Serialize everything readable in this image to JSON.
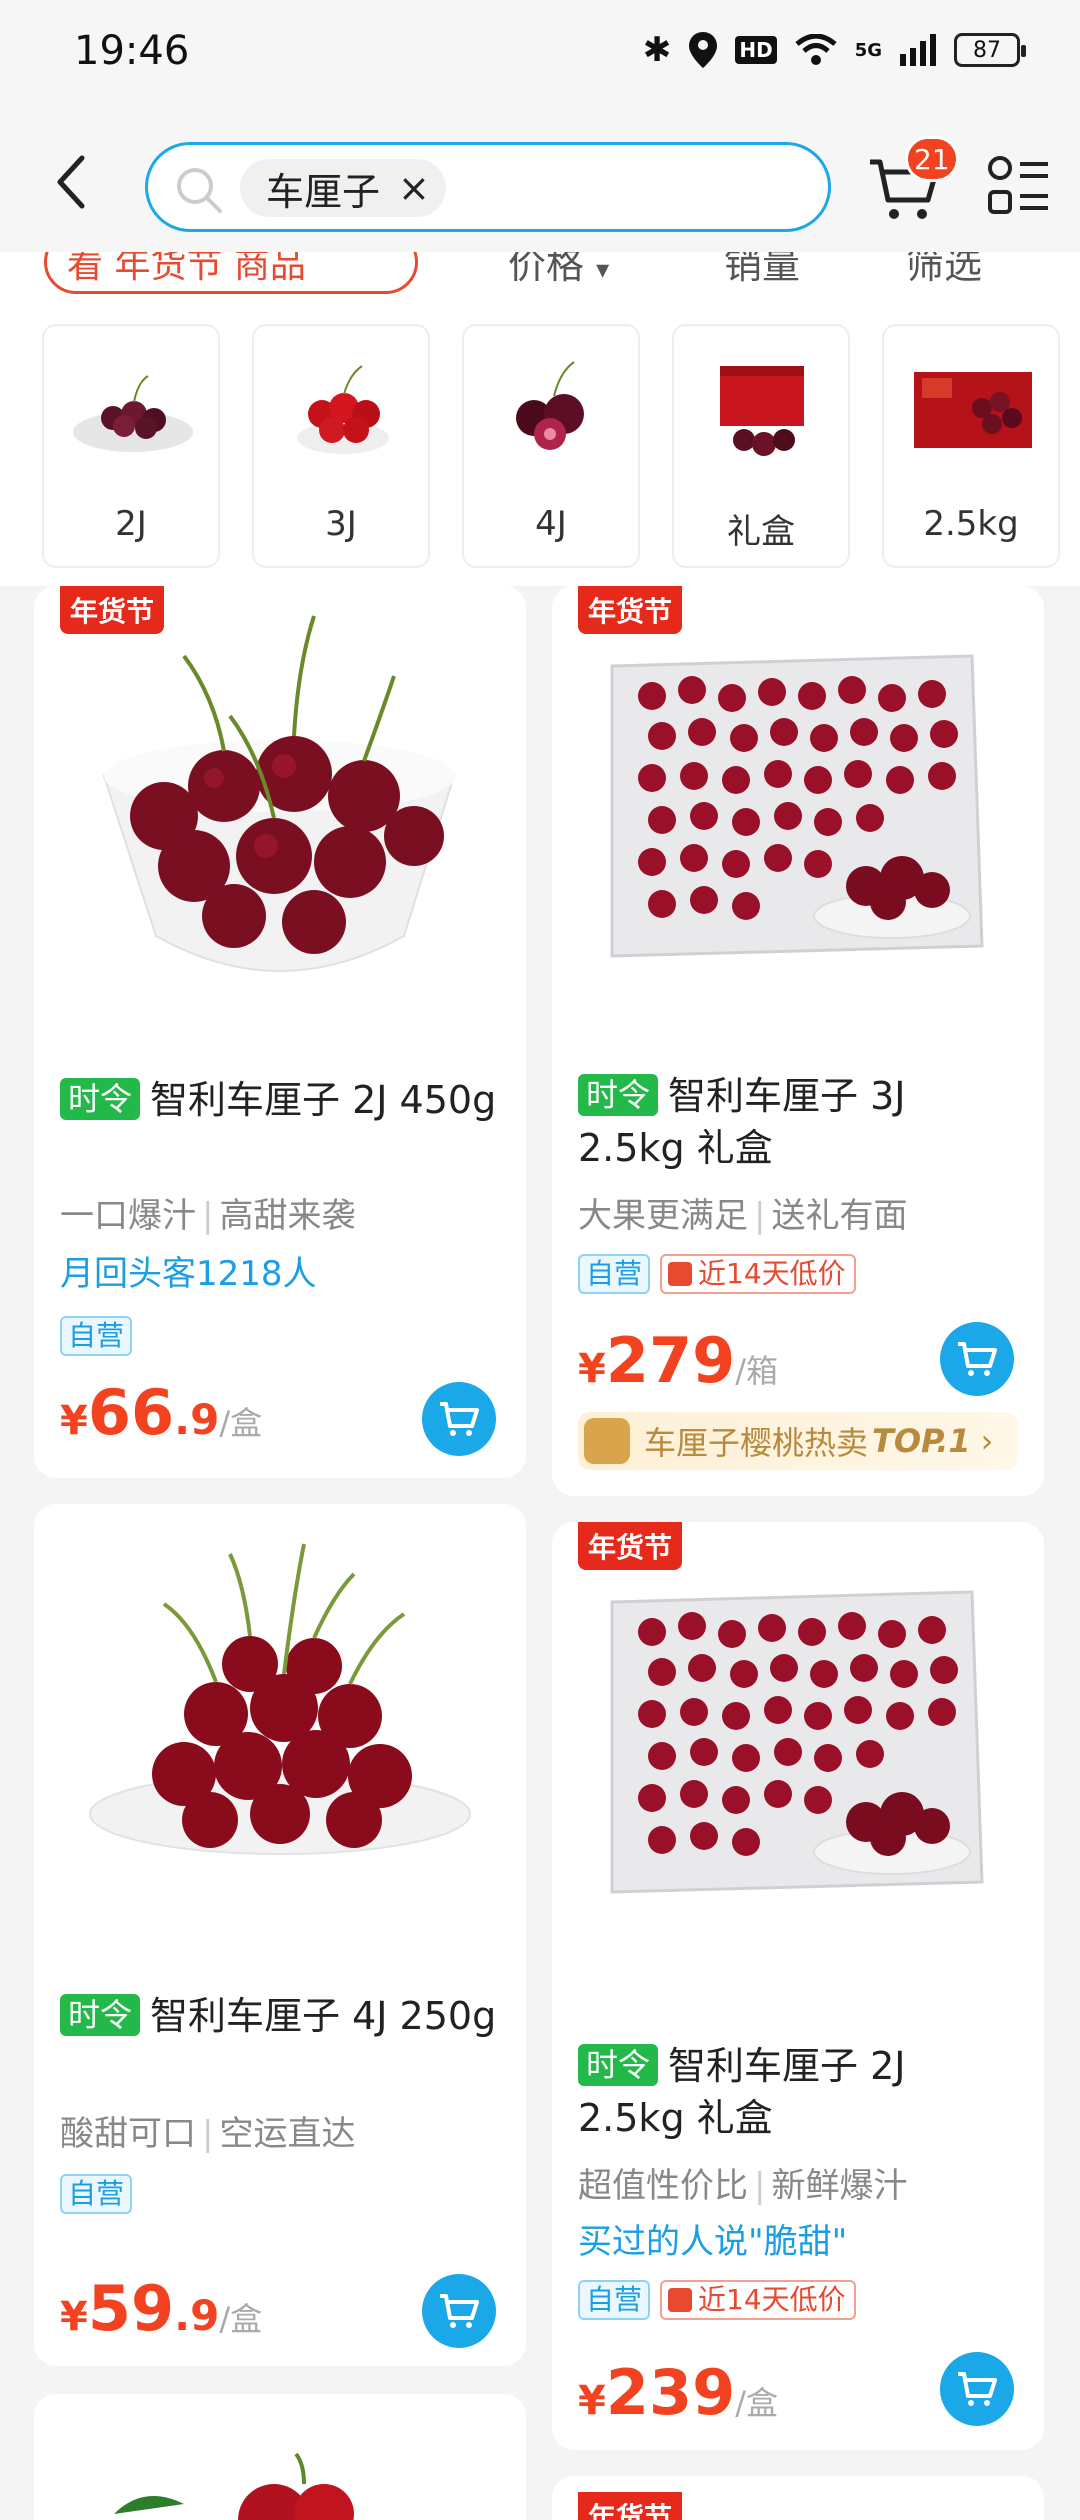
{
  "status_bar": {
    "time": "19:46",
    "network": "5G",
    "hd": "HD",
    "battery": "87"
  },
  "header": {
    "search_query": "车厘子",
    "clear_icon": "×",
    "cart_count": "21"
  },
  "filters": {
    "promo_label": "看 年货节 商品",
    "price": "价格",
    "sort_arrow": "▾",
    "sales": "销量",
    "filter": "筛选"
  },
  "categories": [
    {
      "label": "2J"
    },
    {
      "label": "3J"
    },
    {
      "label": "4J"
    },
    {
      "label": "礼盒"
    },
    {
      "label": "2.5kg"
    }
  ],
  "products": [
    {
      "promo": "年货节",
      "season": "时令",
      "title": "智利车厘子 2J 450g",
      "sub1": "一口爆汁",
      "sub2": "高甜来袭",
      "review": "月回头客1218人",
      "self_tag": "自营",
      "currency": "¥",
      "price_int": "66",
      "price_dec": ".9",
      "unit": "/盒"
    },
    {
      "promo": "年货节",
      "season": "时令",
      "title": "智利车厘子 3J 2.5kg 礼盒",
      "sub1": "大果更满足",
      "sub2": "送礼有面",
      "self_tag": "自营",
      "low_tag": "近14天低价",
      "currency": "¥",
      "price_int": "279",
      "unit": "/箱",
      "hot_text": "车厘子樱桃热卖",
      "hot_rank": "TOP.1"
    },
    {
      "season": "时令",
      "title": "智利车厘子 4J 250g",
      "sub1": "酸甜可口",
      "sub2": "空运直达",
      "self_tag": "自营",
      "currency": "¥",
      "price_int": "59",
      "price_dec": ".9",
      "unit": "/盒"
    },
    {
      "promo": "年货节",
      "season": "时令",
      "title": "智利车厘子 2J 2.5kg 礼盒",
      "sub1": "超值性价比",
      "sub2": "新鲜爆汁",
      "review": "买过的人说\"脆甜\"",
      "self_tag": "自营",
      "low_tag": "近14天低价",
      "currency": "¥",
      "price_int": "239",
      "unit": "/盒"
    },
    {},
    {
      "promo": "年货节"
    }
  ],
  "colors": {
    "accent": "#1aa8e8",
    "price": "#f2421f",
    "season": "#22b94a",
    "promo": "#e52a1c"
  }
}
